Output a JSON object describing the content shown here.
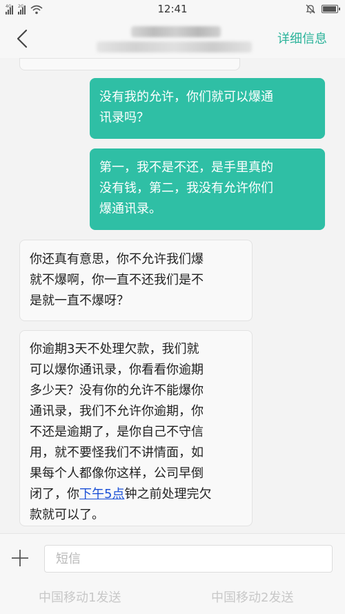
{
  "status_bar": {
    "time": "12:41",
    "signal1_label": "4G",
    "signal2_label": "2G",
    "icons": [
      "signal-icon",
      "wifi-icon",
      "mute-notification-icon",
      "battery-icon"
    ],
    "battery_level": 0.95
  },
  "header": {
    "back_icon": "chevron-left-icon",
    "detail_label": "详细信息"
  },
  "messages": [
    {
      "direction": "out",
      "lines": [
        "没有我的允许，你们就可以爆通",
        "讯录吗？"
      ]
    },
    {
      "direction": "out",
      "lines": [
        "第一，我不是不还，是手里真的",
        "没有钱，第二，我没有允许你们",
        "爆通讯录。"
      ]
    },
    {
      "direction": "in",
      "lines": [
        "你还真有意思，你不允许我们爆",
        "就不爆啊，你一直不还我们是不",
        "是就一直不爆呀？"
      ]
    },
    {
      "direction": "in",
      "lines": [
        "你逾期3天不处理欠款，我们就",
        "可以爆你通讯录，你看看你逾期",
        "多少天？没有你的允许不能爆你",
        "通讯录，我们不允许你逾期，你",
        "不还是逾期了，是你自己不守信",
        "用，就不要怪我们不讲情面，如",
        "果每个人都像你这样，公司早倒"
      ],
      "last_line_prefix": "闭了，你",
      "last_line_link": "下午5点",
      "last_line_suffix": "钟之前处理完欠",
      "final_line": "款就可以了。"
    }
  ],
  "composer": {
    "plus_icon": "plus-icon",
    "placeholder": "短信",
    "send1_label": "中国移动1发送",
    "send2_label": "中国移动2发送"
  },
  "colors": {
    "accent": "#2bb39a",
    "outgoing_bubble": "#2fbfa5",
    "link": "#1a4fd6"
  }
}
